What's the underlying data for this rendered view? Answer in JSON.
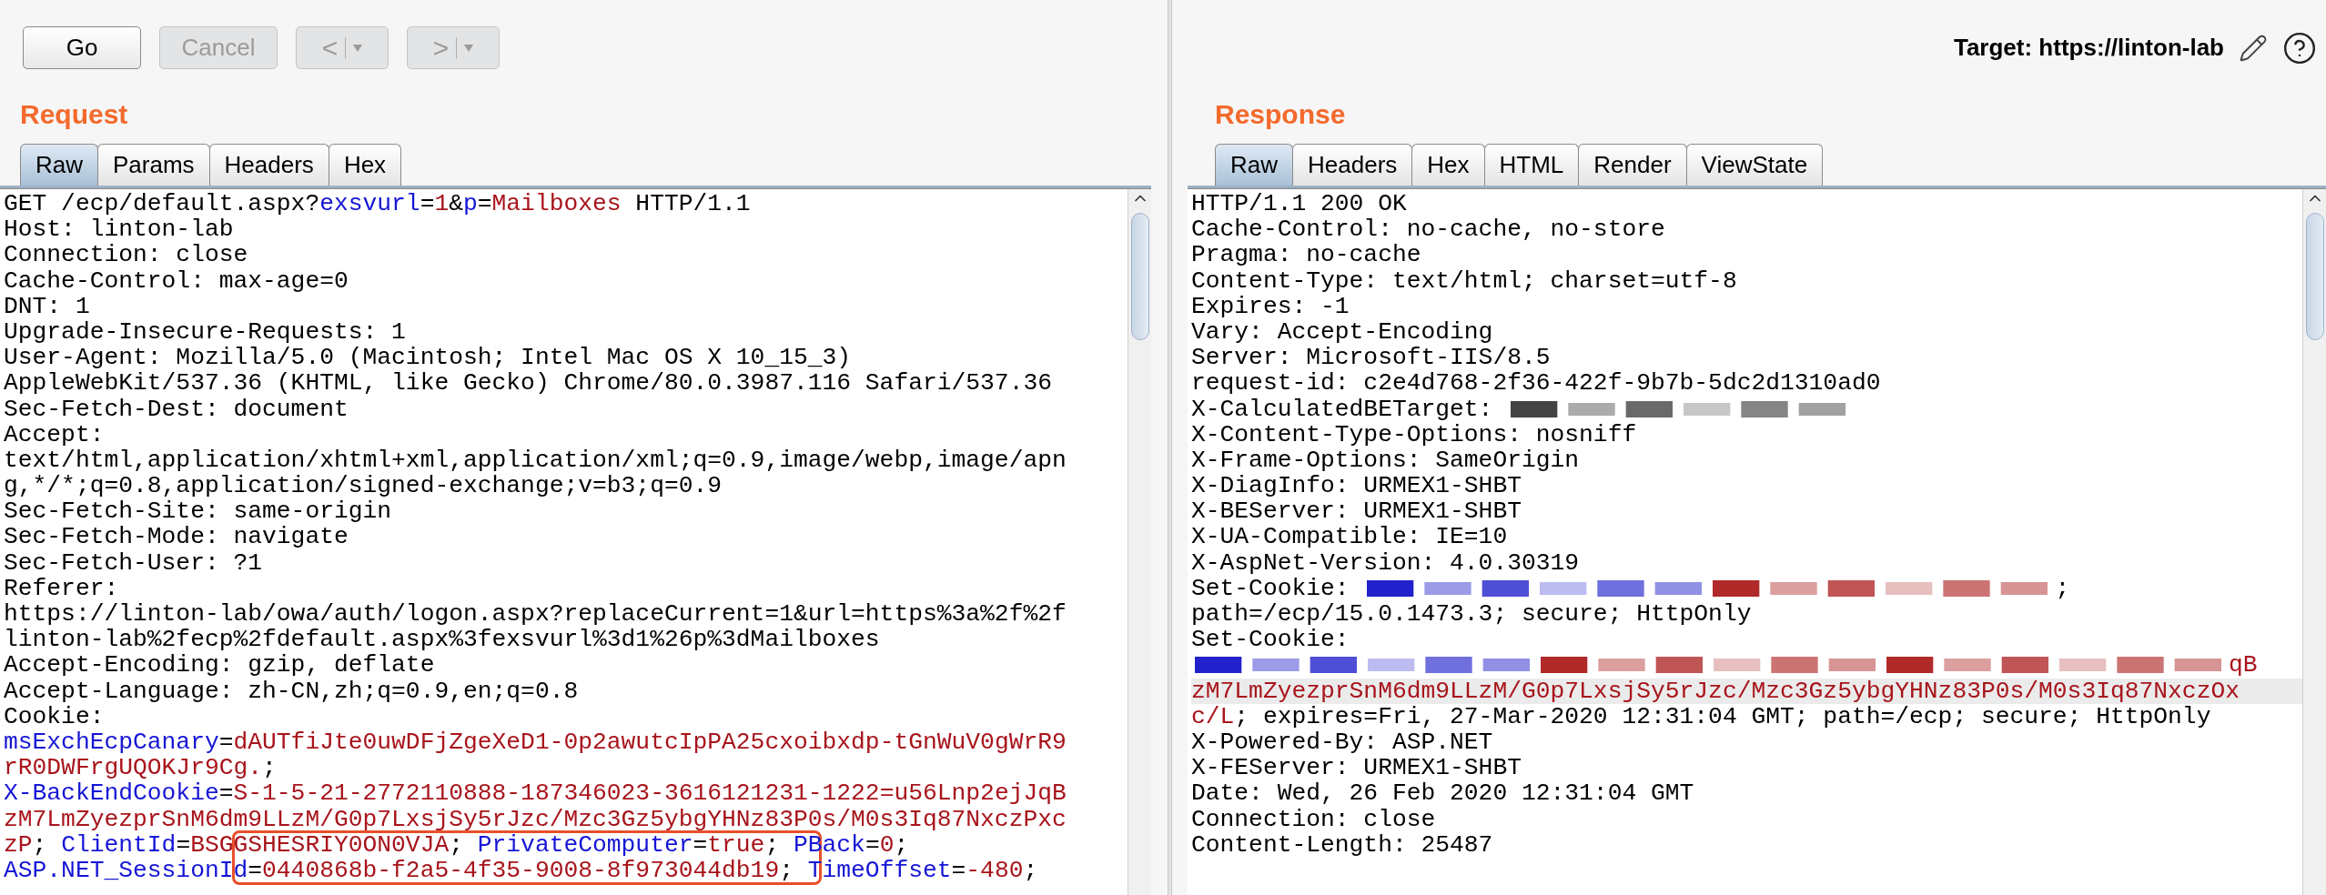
{
  "toolbar": {
    "buttons": [
      {
        "kind": "text",
        "label": "Go",
        "disabled": false
      },
      {
        "kind": "text",
        "label": "Cancel",
        "disabled": true
      },
      {
        "kind": "split",
        "label": "<",
        "disabled": true
      },
      {
        "kind": "split",
        "label": ">",
        "disabled": true
      }
    ],
    "target": "Target: https://linton-lab"
  },
  "panels": [
    {
      "title": "Request",
      "tabs": [
        {
          "label": "Raw",
          "selected": true
        },
        {
          "label": "Params",
          "selected": false
        },
        {
          "label": "Headers",
          "selected": false
        },
        {
          "label": "Hex",
          "selected": false
        }
      ],
      "lines": [
        {
          "highlighted": false,
          "segments": [
            {
              "kind": "plain",
              "t": "GET /ecp/default.aspx?"
            },
            {
              "kind": "key",
              "t": "exsvurl"
            },
            {
              "kind": "plain",
              "t": "="
            },
            {
              "kind": "value",
              "t": "1"
            },
            {
              "kind": "plain",
              "t": "&"
            },
            {
              "kind": "key",
              "t": "p"
            },
            {
              "kind": "plain",
              "t": "="
            },
            {
              "kind": "value",
              "t": "Mailboxes"
            },
            {
              "kind": "plain",
              "t": " HTTP/1.1"
            }
          ]
        },
        {
          "highlighted": false,
          "segments": [
            {
              "kind": "plain",
              "t": "Host: linton-lab"
            }
          ]
        },
        {
          "highlighted": false,
          "segments": [
            {
              "kind": "plain",
              "t": "Connection: close"
            }
          ]
        },
        {
          "highlighted": false,
          "segments": [
            {
              "kind": "plain",
              "t": "Cache-Control: max-age=0"
            }
          ]
        },
        {
          "highlighted": false,
          "segments": [
            {
              "kind": "plain",
              "t": "DNT: 1"
            }
          ]
        },
        {
          "highlighted": false,
          "segments": [
            {
              "kind": "plain",
              "t": "Upgrade-Insecure-Requests: 1"
            }
          ]
        },
        {
          "highlighted": false,
          "segments": [
            {
              "kind": "plain",
              "t": "User-Agent: Mozilla/5.0 (Macintosh; Intel Mac OS X 10_15_3)"
            }
          ]
        },
        {
          "highlighted": false,
          "segments": [
            {
              "kind": "plain",
              "t": "AppleWebKit/537.36 (KHTML, like Gecko) Chrome/80.0.3987.116 Safari/537.36"
            }
          ]
        },
        {
          "highlighted": false,
          "segments": [
            {
              "kind": "plain",
              "t": "Sec-Fetch-Dest: document"
            }
          ]
        },
        {
          "highlighted": false,
          "segments": [
            {
              "kind": "plain",
              "t": "Accept:"
            }
          ]
        },
        {
          "highlighted": false,
          "segments": [
            {
              "kind": "plain",
              "t": "text/html,application/xhtml+xml,application/xml;q=0.9,image/webp,image/apn"
            }
          ]
        },
        {
          "highlighted": false,
          "segments": [
            {
              "kind": "plain",
              "t": "g,*/*;q=0.8,application/signed-exchange;v=b3;q=0.9"
            }
          ]
        },
        {
          "highlighted": false,
          "segments": [
            {
              "kind": "plain",
              "t": "Sec-Fetch-Site: same-origin"
            }
          ]
        },
        {
          "highlighted": false,
          "segments": [
            {
              "kind": "plain",
              "t": "Sec-Fetch-Mode: navigate"
            }
          ]
        },
        {
          "highlighted": false,
          "segments": [
            {
              "kind": "plain",
              "t": "Sec-Fetch-User: ?1"
            }
          ]
        },
        {
          "highlighted": false,
          "segments": [
            {
              "kind": "plain",
              "t": "Referer:"
            }
          ]
        },
        {
          "highlighted": false,
          "segments": [
            {
              "kind": "plain",
              "t": "https://linton-lab/owa/auth/logon.aspx?replaceCurrent=1&url=https%3a%2f%2f"
            }
          ]
        },
        {
          "highlighted": false,
          "segments": [
            {
              "kind": "plain",
              "t": "linton-lab%2fecp%2fdefault.aspx%3fexsvurl%3d1%26p%3dMailboxes"
            }
          ]
        },
        {
          "highlighted": false,
          "segments": [
            {
              "kind": "plain",
              "t": "Accept-Encoding: gzip, deflate"
            }
          ]
        },
        {
          "highlighted": false,
          "segments": [
            {
              "kind": "plain",
              "t": "Accept-Language: zh-CN,zh;q=0.9,en;q=0.8"
            }
          ]
        },
        {
          "highlighted": false,
          "segments": [
            {
              "kind": "plain",
              "t": "Cookie:"
            }
          ]
        },
        {
          "highlighted": false,
          "segments": [
            {
              "kind": "key",
              "t": "msExchEcpCanary"
            },
            {
              "kind": "plain",
              "t": "="
            },
            {
              "kind": "value",
              "t": "dAUTfiJte0uwDFjZgeXeD1-0p2awutcIpPA25cxoibxdp-tGnWuV0gWrR9"
            }
          ]
        },
        {
          "highlighted": false,
          "segments": [
            {
              "kind": "value",
              "t": "rR0DWFrgUQOKJr9Cg."
            },
            {
              "kind": "plain",
              "t": ";"
            }
          ]
        },
        {
          "highlighted": false,
          "segments": [
            {
              "kind": "key",
              "t": "X-BackEndCookie"
            },
            {
              "kind": "plain",
              "t": "="
            },
            {
              "kind": "value",
              "t": "S-1-5-21-2772110888-187346023-3616121231-1222=u56Lnp2ejJqB"
            }
          ]
        },
        {
          "highlighted": false,
          "segments": [
            {
              "kind": "value",
              "t": "zM7LmZyezprSnM6dm9LLzM/G0p7LxsjSy5rJzc/Mzc3Gz5ybgYHNz83P0s/M0s3Iq87NxczPxc"
            }
          ]
        },
        {
          "highlighted": false,
          "segments": [
            {
              "kind": "value",
              "t": "zP"
            },
            {
              "kind": "plain",
              "t": "; "
            },
            {
              "kind": "key",
              "t": "ClientId"
            },
            {
              "kind": "plain",
              "t": "="
            },
            {
              "kind": "value",
              "t": "BSGGSHESRIY0ON0VJA"
            },
            {
              "kind": "plain",
              "t": "; "
            },
            {
              "kind": "key",
              "t": "PrivateComputer"
            },
            {
              "kind": "plain",
              "t": "="
            },
            {
              "kind": "value",
              "t": "true"
            },
            {
              "kind": "plain",
              "t": "; "
            },
            {
              "kind": "key",
              "t": "PBack"
            },
            {
              "kind": "plain",
              "t": "="
            },
            {
              "kind": "value",
              "t": "0"
            },
            {
              "kind": "plain",
              "t": ";"
            }
          ]
        },
        {
          "highlighted": false,
          "segments": [
            {
              "kind": "key",
              "t": "ASP.NET_SessionId"
            },
            {
              "kind": "plain",
              "t": "="
            },
            {
              "kind": "value",
              "t": "0440868b-f2a5-4f35-9008-8f973044db19"
            },
            {
              "kind": "plain",
              "t": "; "
            },
            {
              "kind": "key",
              "t": "TimeOffset"
            },
            {
              "kind": "plain",
              "t": "="
            },
            {
              "kind": "value",
              "t": "-480"
            },
            {
              "kind": "plain",
              "t": ";"
            }
          ]
        }
      ]
    },
    {
      "title": "Response",
      "tabs": [
        {
          "label": "Raw",
          "selected": true
        },
        {
          "label": "Headers",
          "selected": false
        },
        {
          "label": "Hex",
          "selected": false
        },
        {
          "label": "HTML",
          "selected": false
        },
        {
          "label": "Render",
          "selected": false
        },
        {
          "label": "ViewState",
          "selected": false
        }
      ],
      "lines": [
        {
          "highlighted": false,
          "segments": [
            {
              "kind": "plain",
              "t": "HTTP/1.1 200 OK"
            }
          ]
        },
        {
          "highlighted": false,
          "segments": [
            {
              "kind": "plain",
              "t": "Cache-Control: no-cache, no-store"
            }
          ]
        },
        {
          "highlighted": false,
          "segments": [
            {
              "kind": "plain",
              "t": "Pragma: no-cache"
            }
          ]
        },
        {
          "highlighted": false,
          "segments": [
            {
              "kind": "plain",
              "t": "Content-Type: text/html; charset=utf-8"
            }
          ]
        },
        {
          "highlighted": false,
          "segments": [
            {
              "kind": "plain",
              "t": "Expires: -1"
            }
          ]
        },
        {
          "highlighted": false,
          "segments": [
            {
              "kind": "plain",
              "t": "Vary: Accept-Encoding"
            }
          ]
        },
        {
          "highlighted": false,
          "segments": [
            {
              "kind": "plain",
              "t": "Server: Microsoft-IIS/8.5"
            }
          ]
        },
        {
          "highlighted": false,
          "segments": [
            {
              "kind": "plain",
              "t": "request-id: c2e4d768-2f36-422f-9b7b-5dc2d1310ad0"
            }
          ]
        },
        {
          "highlighted": false,
          "segments": [
            {
              "kind": "plain",
              "t": "X-CalculatedBETarget: "
            },
            {
              "kind": "redacted",
              "color": "#444444"
            }
          ]
        },
        {
          "highlighted": false,
          "segments": [
            {
              "kind": "plain",
              "t": "X-Content-Type-Options: nosniff"
            }
          ]
        },
        {
          "highlighted": false,
          "segments": [
            {
              "kind": "plain",
              "t": "X-Frame-Options: SameOrigin"
            }
          ]
        },
        {
          "highlighted": false,
          "segments": [
            {
              "kind": "plain",
              "t": "X-DiagInfo: URMEX1-SHBT"
            }
          ]
        },
        {
          "highlighted": false,
          "segments": [
            {
              "kind": "plain",
              "t": "X-BEServer: URMEX1-SHBT"
            }
          ]
        },
        {
          "highlighted": false,
          "segments": [
            {
              "kind": "plain",
              "t": "X-UA-Compatible: IE=10"
            }
          ]
        },
        {
          "highlighted": false,
          "segments": [
            {
              "kind": "plain",
              "t": "X-AspNet-Version: 4.0.30319"
            }
          ]
        },
        {
          "highlighted": false,
          "segments": [
            {
              "kind": "plain",
              "t": "Set-Cookie: "
            },
            {
              "kind": "redacted",
              "color": "#2222cc"
            },
            {
              "kind": "redacted",
              "color": "#b02a2a"
            },
            {
              "kind": "plain",
              "t": ";"
            }
          ]
        },
        {
          "highlighted": false,
          "segments": [
            {
              "kind": "plain",
              "t": "path=/ecp/15.0.1473.3; secure; HttpOnly"
            }
          ]
        },
        {
          "highlighted": false,
          "segments": [
            {
              "kind": "plain",
              "t": "Set-Cookie:"
            }
          ]
        },
        {
          "highlighted": false,
          "segments": [
            {
              "kind": "redacted",
              "color": "#2222cc"
            },
            {
              "kind": "redacted",
              "color": "#b02a2a"
            },
            {
              "kind": "redacted",
              "color": "#b02a2a"
            },
            {
              "kind": "value",
              "t": "qB"
            }
          ]
        },
        {
          "highlighted": true,
          "segments": [
            {
              "kind": "value",
              "t": "zM7LmZyezprSnM6dm9LLzM/G0p7LxsjSy5rJzc/Mzc3Gz5ybgYHNz83P0s/M0s3Iq87NxczOx"
            }
          ]
        },
        {
          "highlighted": false,
          "segments": [
            {
              "kind": "value",
              "t": "c/L"
            },
            {
              "kind": "plain",
              "t": "; expires=Fri, 27-Mar-2020 12:31:04 GMT; path=/ecp; secure; HttpOnly"
            }
          ]
        },
        {
          "highlighted": false,
          "segments": [
            {
              "kind": "plain",
              "t": "X-Powered-By: ASP.NET"
            }
          ]
        },
        {
          "highlighted": false,
          "segments": [
            {
              "kind": "plain",
              "t": "X-FEServer: URMEX1-SHBT"
            }
          ]
        },
        {
          "highlighted": false,
          "segments": [
            {
              "kind": "plain",
              "t": "Date: Wed, 26 Feb 2020 12:31:04 GMT"
            }
          ]
        },
        {
          "highlighted": false,
          "segments": [
            {
              "kind": "plain",
              "t": "Connection: close"
            }
          ]
        },
        {
          "highlighted": false,
          "segments": [
            {
              "kind": "plain",
              "t": "Content-Length: 25487"
            }
          ]
        }
      ]
    }
  ]
}
